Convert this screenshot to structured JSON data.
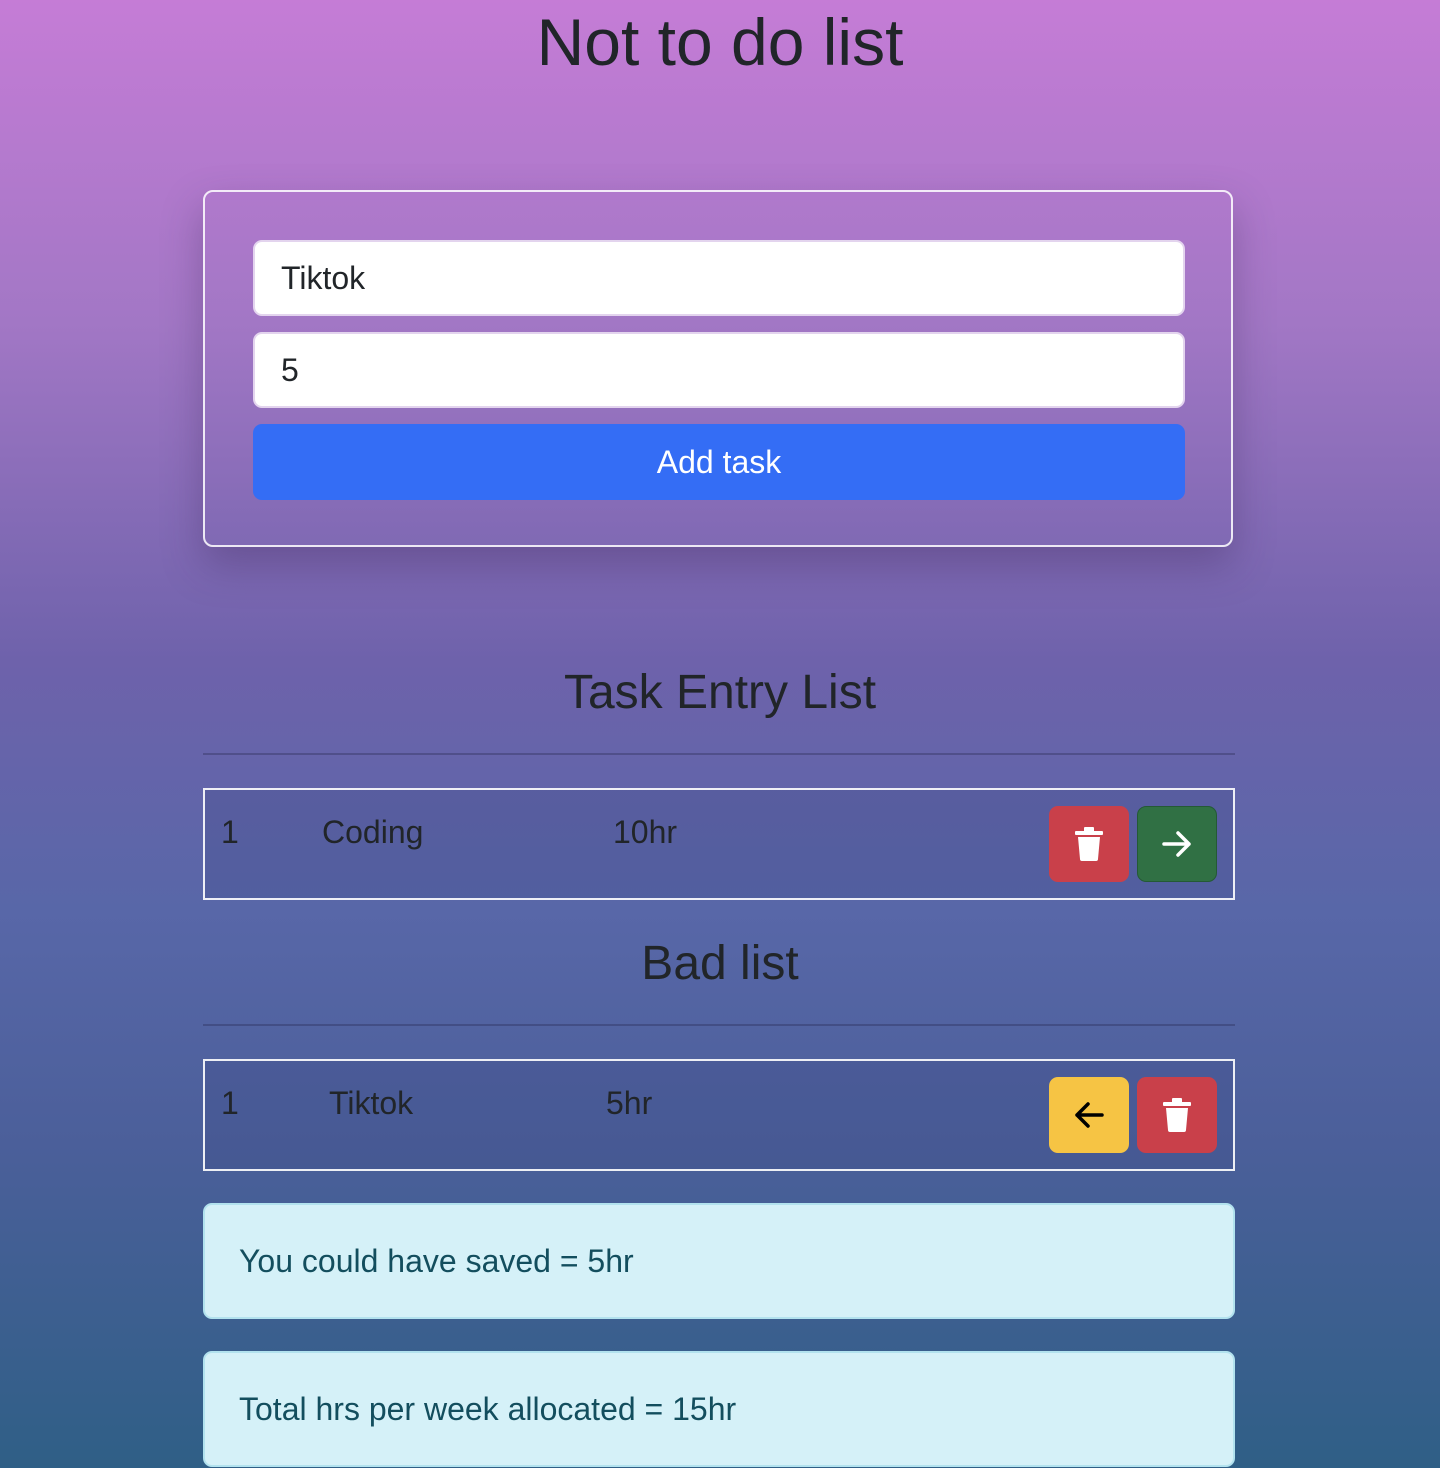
{
  "header": {
    "title": "Not to do list"
  },
  "form": {
    "task_value": "Tiktok",
    "hours_value": "5",
    "add_label": "Add task"
  },
  "task_entry": {
    "heading": "Task Entry List",
    "rows": [
      {
        "index": "1",
        "task": "Coding",
        "hours": "10hr"
      }
    ]
  },
  "bad_list": {
    "heading": "Bad list",
    "rows": [
      {
        "index": "1",
        "task": "Tiktok",
        "hours": "5hr"
      }
    ]
  },
  "summary": {
    "saved_text": "You could have saved = 5hr",
    "total_text": "Total hrs per week allocated = 15hr"
  },
  "icons": {
    "delete": "trash-icon",
    "move_right": "arrow-right-icon",
    "move_left": "arrow-left-icon"
  },
  "colors": {
    "primary": "#346df5",
    "danger": "#c9404a",
    "success": "#307044",
    "warning": "#f6c444",
    "info_bg": "#d5f1f8"
  }
}
